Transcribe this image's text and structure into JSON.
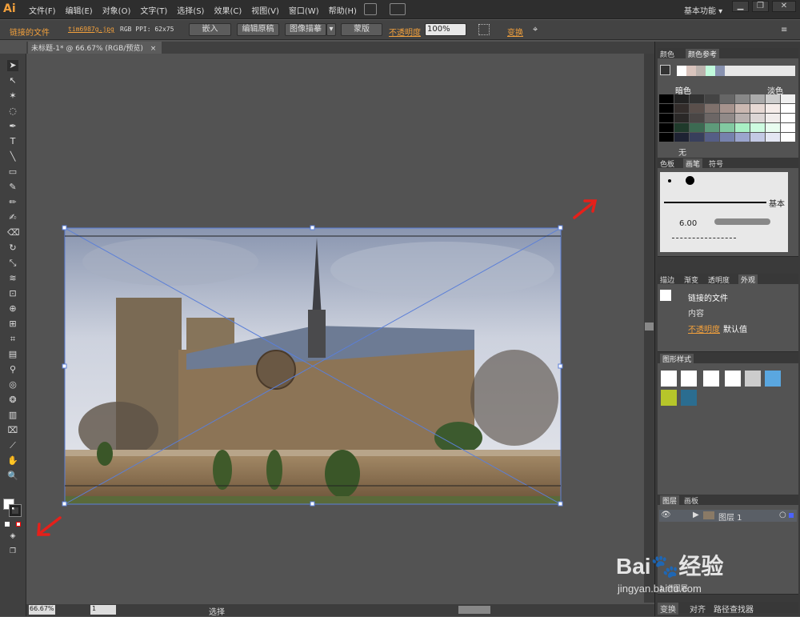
{
  "menubar": {
    "logo": "Ai",
    "items": [
      "文件(F)",
      "编辑(E)",
      "对象(O)",
      "文字(T)",
      "选择(S)",
      "效果(C)",
      "视图(V)",
      "窗口(W)",
      "帮助(H)"
    ],
    "workspace": "基本功能",
    "win": [
      "▁",
      "❐",
      "✕"
    ]
  },
  "controlbar": {
    "linked": "链接的文件",
    "filename": "tim6987g.jpg",
    "info": "RGB  PPI: 62x75",
    "embed": "嵌入",
    "edit_original": "编辑原稿",
    "image_trace": "图像描摹",
    "mask": "蒙版",
    "opacity_label": "不透明度",
    "opacity_value": "100%",
    "transform": "变换"
  },
  "document": {
    "tab": "未标题-1* @ 66.67% (RGB/预览)",
    "close": "×"
  },
  "colorguide": {
    "tab1": "颜色",
    "tab2": "颜色参考",
    "dark": "暗色",
    "light": "淡色",
    "none": "无"
  },
  "brushes": {
    "tabs": [
      "色板",
      "画笔",
      "符号"
    ],
    "basic": "基本",
    "size": "6.00"
  },
  "appearance": {
    "tabs": [
      "描边",
      "渐变",
      "透明度",
      "外观"
    ],
    "linked": "链接的文件",
    "content": "内容",
    "opacity": "不透明度",
    "opacity_val": "默认值"
  },
  "graphicstyles": {
    "tab": "图形样式"
  },
  "layers": {
    "tabs": [
      "图层",
      "画板"
    ],
    "layer1": "图层 1",
    "count": "1 个图层"
  },
  "bottom": {
    "tabs": [
      "变换",
      "对齐",
      "路径查找器"
    ]
  },
  "status": {
    "zoom": "66.67%",
    "page": "1",
    "tool": "选择"
  },
  "watermark": {
    "brand": "Bai🐾经验",
    "url": "jingyan.baidu.com"
  }
}
